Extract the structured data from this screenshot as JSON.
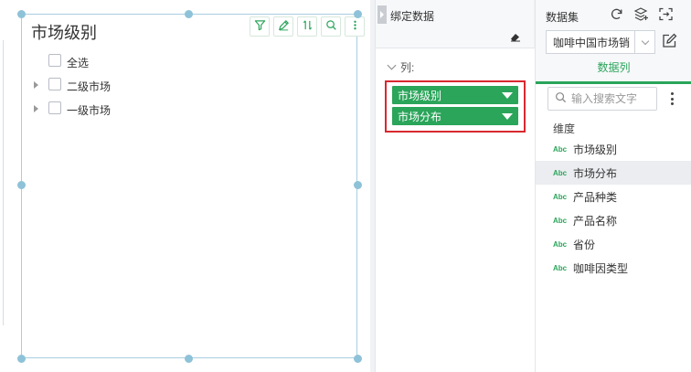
{
  "widget": {
    "title": "市场级别",
    "tree": [
      {
        "label": "全选",
        "expandable": false
      },
      {
        "label": "二级市场",
        "expandable": true
      },
      {
        "label": "一级市场",
        "expandable": true
      }
    ],
    "tools": [
      "filter-icon",
      "edit-pencil-icon",
      "sort-icon",
      "search-icon",
      "more-vertical-icon"
    ]
  },
  "bind_panel": {
    "title": "绑定数据",
    "section_label": "列:",
    "bound_fields": [
      "市场级别",
      "市场分布"
    ],
    "accent": "#2aa55a",
    "highlight_border": "#d9282f"
  },
  "dataset_panel": {
    "title": "数据集",
    "selected_dataset": "咖啡中国市场销",
    "tab": "数据列",
    "search_placeholder": "输入搜索文字",
    "group_label": "维度",
    "field_type_badge": "Abc",
    "fields": [
      {
        "label": "市场级别",
        "selected": false
      },
      {
        "label": "市场分布",
        "selected": true
      },
      {
        "label": "产品种类",
        "selected": false
      },
      {
        "label": "产品名称",
        "selected": false
      },
      {
        "label": "省份",
        "selected": false
      },
      {
        "label": "咖啡因类型",
        "selected": false
      }
    ]
  }
}
